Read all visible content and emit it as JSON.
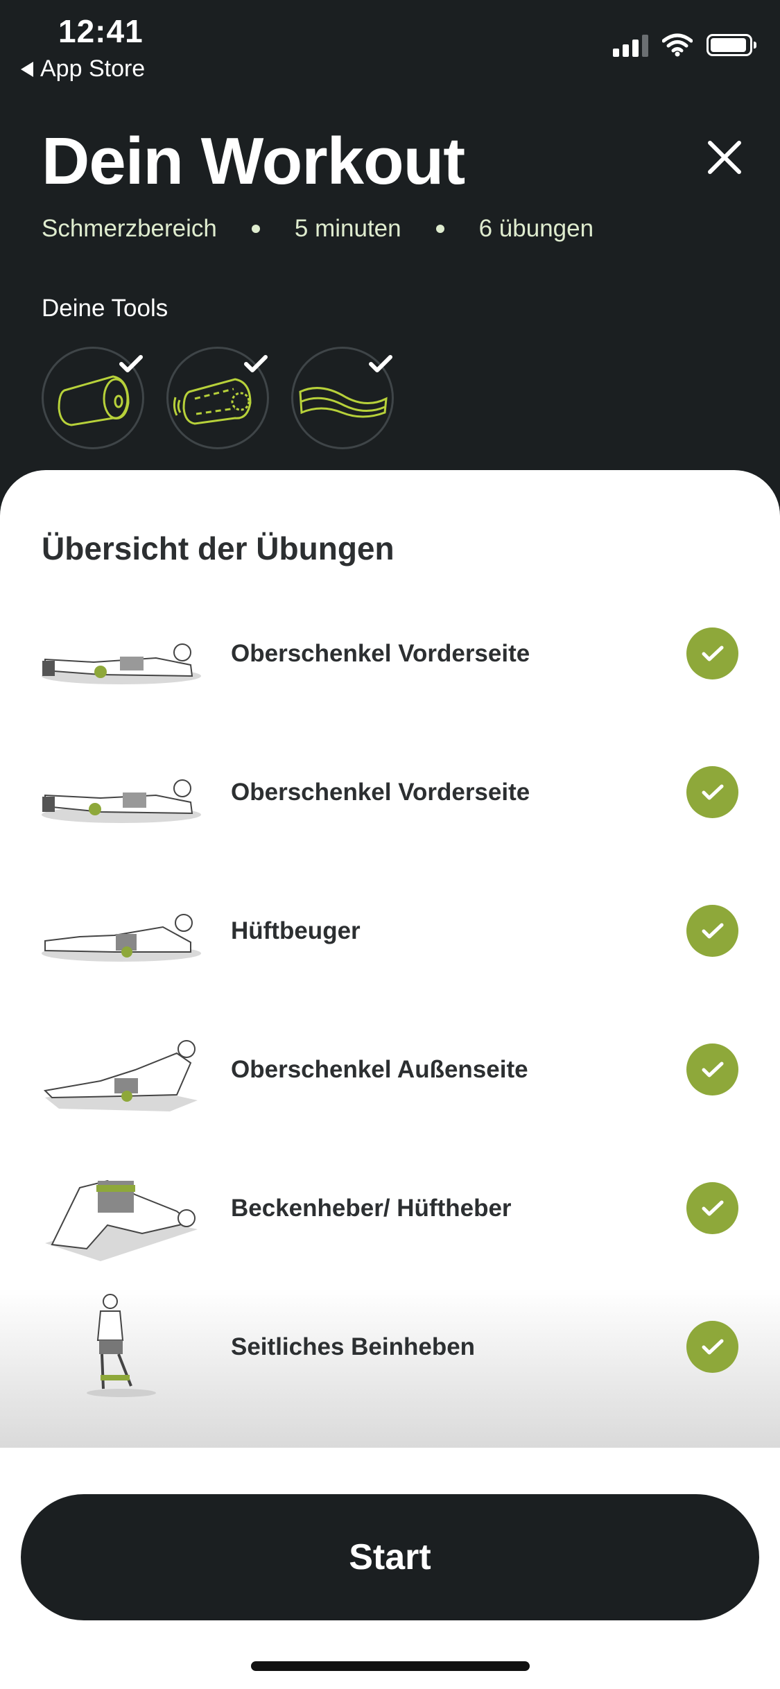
{
  "status": {
    "time": "12:41",
    "back_label": "App Store"
  },
  "header": {
    "title": "Dein Workout",
    "meta": [
      "Schmerzbereich",
      "5 minuten",
      "6 übungen"
    ],
    "tools_label": "Deine Tools",
    "tools": [
      {
        "icon": "foam-roller-icon",
        "checked": true
      },
      {
        "icon": "vibration-roller-icon",
        "checked": true
      },
      {
        "icon": "resistance-band-icon",
        "checked": true
      }
    ]
  },
  "overview": {
    "title": "Übersicht der Übungen",
    "exercises": [
      {
        "label": "Oberschenkel Vorderseite",
        "done": true
      },
      {
        "label": "Oberschenkel Vorderseite",
        "done": true
      },
      {
        "label": "Hüftbeuger",
        "done": true
      },
      {
        "label": "Oberschenkel Außenseite",
        "done": true
      },
      {
        "label": "Beckenheber/ Hüftheber",
        "done": true
      },
      {
        "label": "Seitliches Beinheben",
        "done": true
      }
    ]
  },
  "footer": {
    "start_label": "Start"
  },
  "colors": {
    "dark": "#1b1f21",
    "accent": "#8ea83a",
    "line_green": "#b7d13a",
    "meta_text": "#dfeccf"
  }
}
